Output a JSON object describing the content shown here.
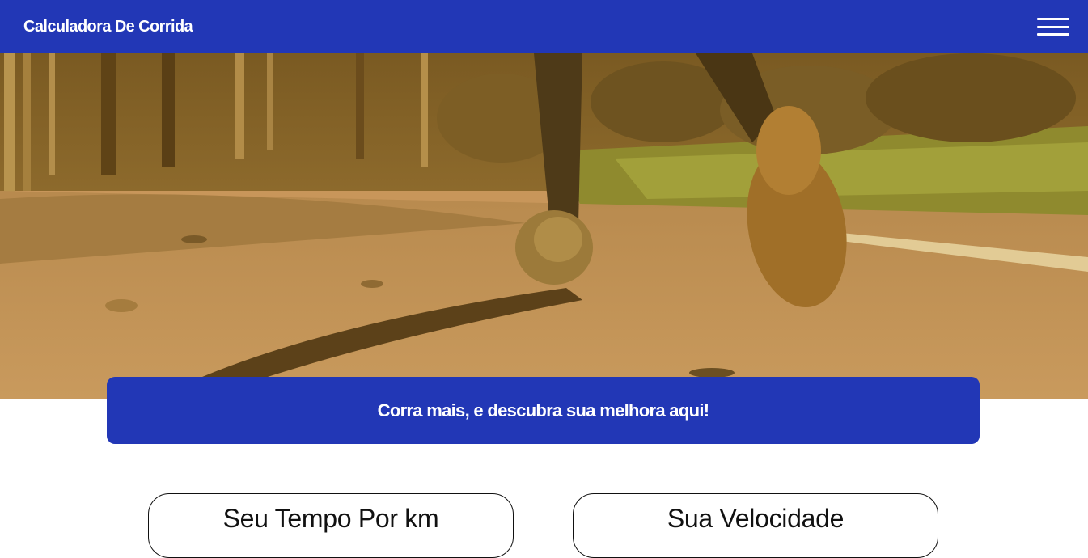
{
  "header": {
    "brand": "Calculadora De Corrida",
    "menu_icon": "hamburger-menu-icon"
  },
  "hero": {
    "image": "runner-photo"
  },
  "banner": {
    "text": "Corra mais, e descubra sua melhora aqui!"
  },
  "cards": [
    {
      "title": "Seu Tempo Por km"
    },
    {
      "title": "Sua Velocidade"
    }
  ],
  "colors": {
    "primary": "#2237b6",
    "text_dark": "#111111",
    "background": "#ffffff"
  }
}
